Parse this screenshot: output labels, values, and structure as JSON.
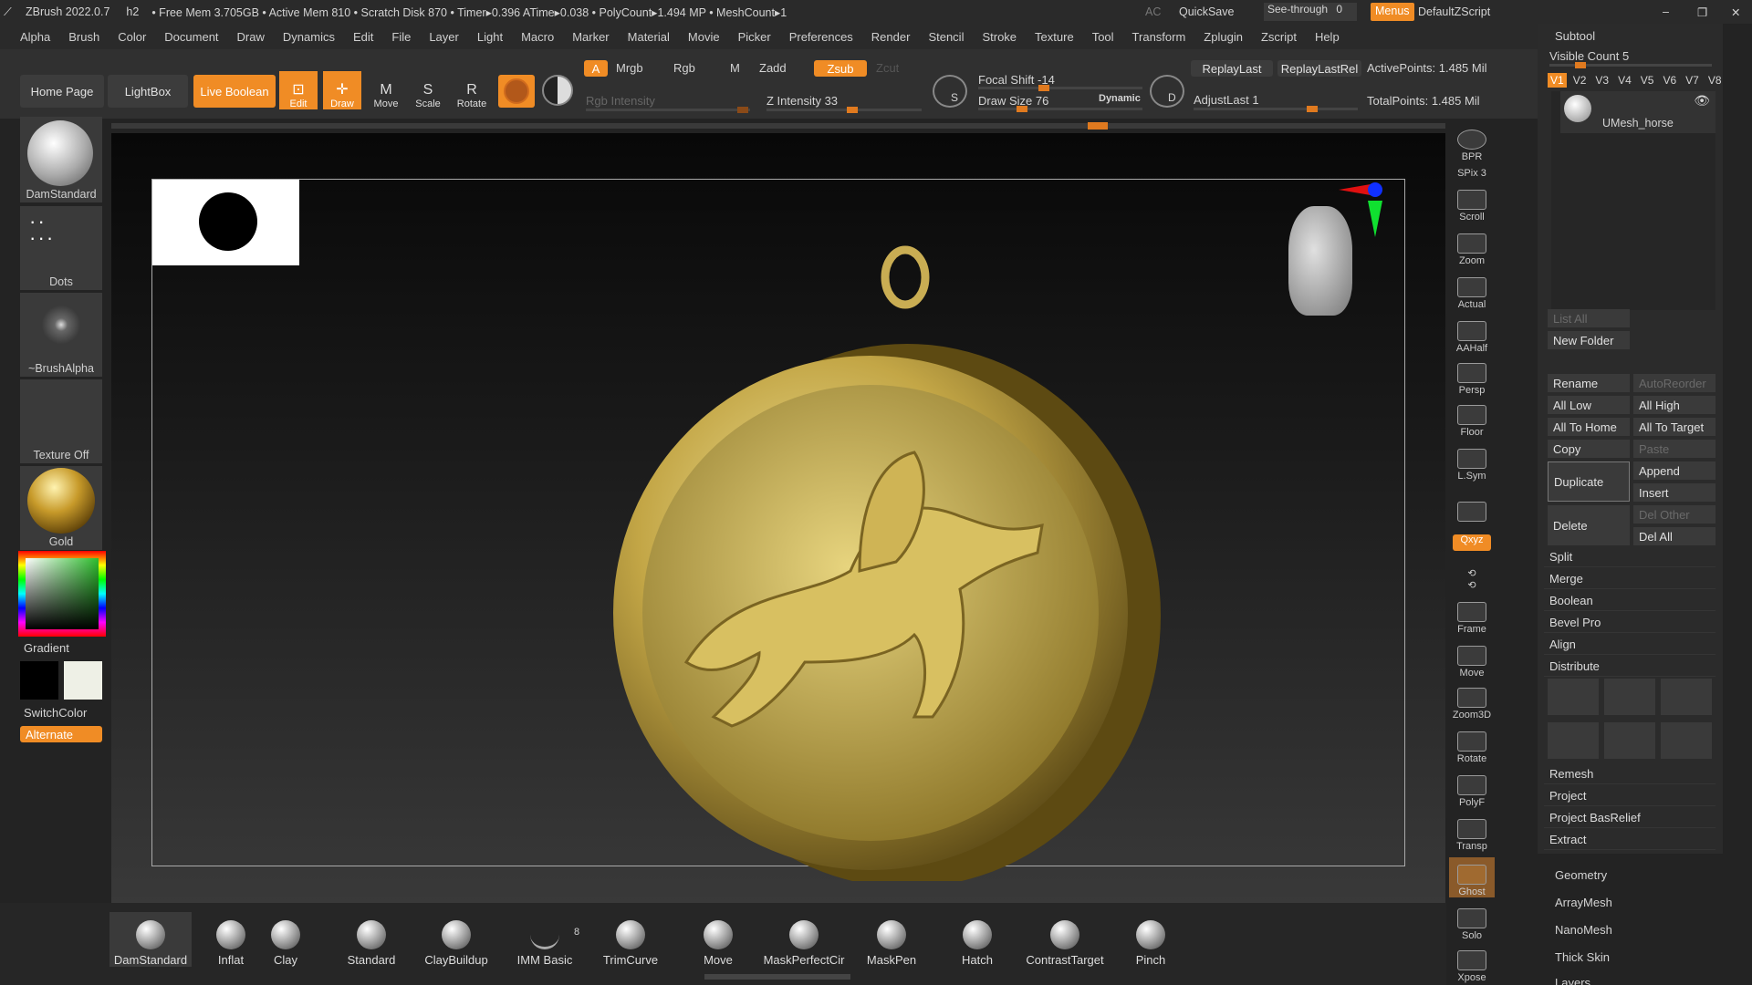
{
  "titlebar": {
    "app": "ZBrush 2022.0.7",
    "doc": "h2",
    "stats": "• Free Mem 3.705GB • Active Mem 810 • Scratch Disk 870 • Timer▸0.396 ATime▸0.038 • PolyCount▸1.494 MP • MeshCount▸1",
    "ac": "AC",
    "quicksave": "QuickSave",
    "seethrough": "See-through",
    "seethrough_val": "0",
    "menus": "Menus",
    "script": "DefaultZScript"
  },
  "menu": [
    "Alpha",
    "Brush",
    "Color",
    "Document",
    "Draw",
    "Dynamics",
    "Edit",
    "File",
    "Layer",
    "Light",
    "Macro",
    "Marker",
    "Material",
    "Movie",
    "Picker",
    "Preferences",
    "Render",
    "Stencil",
    "Stroke",
    "Texture",
    "Tool",
    "Transform",
    "Zplugin",
    "Zscript",
    "Help"
  ],
  "toolbar": {
    "home": "Home Page",
    "lightbox": "LightBox",
    "liveboolean": "Live Boolean",
    "edit": "Edit",
    "draw": "Draw",
    "move": "Move",
    "scale": "Scale",
    "rotate": "Rotate",
    "a": "A",
    "mrgb": "Mrgb",
    "rgb": "Rgb",
    "m": "M",
    "zadd": "Zadd",
    "zsub": "Zsub",
    "zcut": "Zcut",
    "rgb_intensity": "Rgb Intensity",
    "z_intensity": "Z Intensity 33",
    "focal_shift": "Focal Shift -14",
    "draw_size": "Draw Size 76",
    "dynamic": "Dynamic",
    "replaylast": "ReplayLast",
    "replaylastrel": "ReplayLastRel",
    "adjustlast": "AdjustLast 1",
    "activepoints": "ActivePoints: 1.485 Mil",
    "totalpoints": "TotalPoints: 1.485 Mil",
    "s": "S",
    "d": "D"
  },
  "left": {
    "brush": "DamStandard",
    "stroke": "Dots",
    "alpha": "~BrushAlpha",
    "texture": "Texture Off",
    "material": "Gold",
    "gradient": "Gradient",
    "switchcolor": "SwitchColor",
    "alternate": "Alternate"
  },
  "right": [
    "BPR",
    "SPix 3",
    "Scroll",
    "Zoom",
    "Actual",
    "AAHalf",
    "Persp",
    "Floor",
    "L.Sym",
    "",
    "Qxyz",
    "",
    "Frame",
    "Move",
    "Zoom3D",
    "Rotate",
    "PolyF",
    "Transp",
    "Ghost",
    "Solo",
    "Xpose"
  ],
  "panel": {
    "title": "Subtool",
    "visible": "Visible Count 5",
    "versions": [
      "V1",
      "V2",
      "V3",
      "V4",
      "V5",
      "V6",
      "V7",
      "V8"
    ],
    "subtool": "UMesh_horse",
    "listall": "List All",
    "newfolder": "New Folder",
    "rename": "Rename",
    "autoreorder": "AutoReorder",
    "alllow": "All Low",
    "allhigh": "All High",
    "alltohome": "All To Home",
    "alltotarget": "All To Target",
    "copy": "Copy",
    "paste": "Paste",
    "duplicate": "Duplicate",
    "append": "Append",
    "insert": "Insert",
    "delete": "Delete",
    "delother": "Del Other",
    "delall": "Del All",
    "items": [
      "Split",
      "Merge",
      "Boolean",
      "Bevel Pro",
      "Align",
      "Distribute",
      "Remesh",
      "Project",
      "Project BasRelief",
      "Extract"
    ],
    "lower": [
      "Geometry",
      "ArrayMesh",
      "NanoMesh",
      "Thick Skin",
      "Layers"
    ]
  },
  "bottom": [
    "DamStandard",
    "Inflat",
    "Clay",
    "Standard",
    "ClayBuildup",
    "IMM Basic",
    "TrimCurve",
    "Move",
    "MaskPerfectCir",
    "MaskPen",
    "Hatch",
    "ContrastTarget",
    "Pinch"
  ],
  "bottom_badge": "8"
}
